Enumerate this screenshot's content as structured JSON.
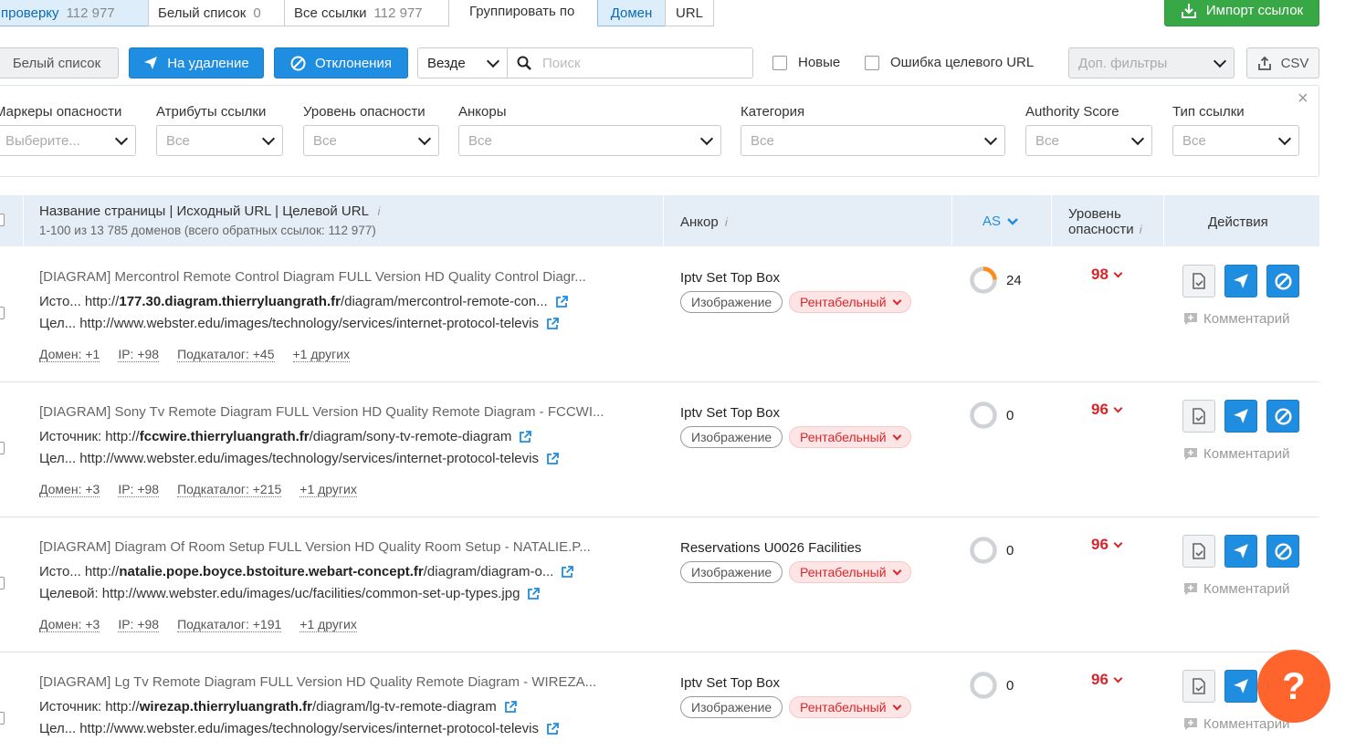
{
  "top_tabs": [
    {
      "label": "проверку",
      "count": "112 977"
    },
    {
      "label": "Белый список",
      "count": "0"
    },
    {
      "label": "Все ссылки",
      "count": "112 977"
    }
  ],
  "group_by": {
    "label": "Группировать по",
    "options": [
      "Домен",
      "URL"
    ],
    "active": "Домен"
  },
  "import_button": "Импорт ссылок",
  "toolbar": {
    "whitelist": "Белый список",
    "to_delete": "На удаление",
    "rejections": "Отклонения",
    "scope_select": "Везде",
    "search_placeholder": "Поиск",
    "new_label": "Новые",
    "target_error_label": "Ошибка целевого URL",
    "extra_filters": "Доп. фильтры",
    "csv": "CSV"
  },
  "filters": [
    {
      "label": "Маркеры опасности",
      "value": "Выберите..."
    },
    {
      "label": "Атрибуты ссылки",
      "value": "Все"
    },
    {
      "label": "Уровень опасности",
      "value": "Все"
    },
    {
      "label": "Анкоры",
      "value": "Все"
    },
    {
      "label": "Категория",
      "value": "Все"
    },
    {
      "label": "Authority Score",
      "value": "Все"
    },
    {
      "label": "Тип ссылки",
      "value": "Все"
    }
  ],
  "close_symbol": "×",
  "table_header": {
    "page_col": "Название страницы | Исходный URL | Целевой URL",
    "page_col_sub": "1-100 из 13 785 доменов (всего обратных ссылок: 112 977)",
    "anchor_col": "Анкор",
    "as_col": "AS",
    "tox_col_1": "Уровень",
    "tox_col_2": "опасности",
    "actions_col": "Действия",
    "info": "i"
  },
  "rows": [
    {
      "title": "[DIAGRAM] Mercontrol Remote Control Diagram FULL Version HD Quality Control Diagr...",
      "src_label": "Исто...",
      "src_pre": "http://",
      "src_bold": "177.30.diagram.thierryluangrath.fr",
      "src_post": "/diagram/mercontrol-remote-con...",
      "tgt_label": "Цел...",
      "tgt_url": "http://www.webster.edu/images/technology/services/internet-protocol-televis",
      "meta": [
        "Домен: +1",
        "IP: +98",
        "Подкаталог: +45",
        "+1 других"
      ],
      "anchor": "Iptv Set Top Box",
      "type_tag": "Изображение",
      "status_tag": "Рентабельный",
      "as": "24",
      "as_fraction": 0.24,
      "tox": "98",
      "comment": "Комментарий"
    },
    {
      "title": "[DIAGRAM] Sony Tv Remote Diagram FULL Version HD Quality Remote Diagram - FCCWI...",
      "src_label": "Источник:",
      "src_pre": "http://",
      "src_bold": "fccwire.thierryluangrath.fr",
      "src_post": "/diagram/sony-tv-remote-diagram",
      "tgt_label": "Цел...",
      "tgt_url": "http://www.webster.edu/images/technology/services/internet-protocol-televis",
      "meta": [
        "Домен: +3",
        "IP: +98",
        "Подкаталог: +215",
        "+1 других"
      ],
      "anchor": "Iptv Set Top Box",
      "type_tag": "Изображение",
      "status_tag": "Рентабельный",
      "as": "0",
      "as_fraction": 0,
      "tox": "96",
      "comment": "Комментарий"
    },
    {
      "title": "[DIAGRAM] Diagram Of Room Setup FULL Version HD Quality Room Setup - NATALIE.P...",
      "src_label": "Исто...",
      "src_pre": "http://",
      "src_bold": "natalie.pope.boyce.bstoiture.webart-concept.fr",
      "src_post": "/diagram/diagram-o...",
      "tgt_label": "Целевой:",
      "tgt_url": "http://www.webster.edu/images/uc/facilities/common-set-up-types.jpg",
      "meta": [
        "Домен: +3",
        "IP: +98",
        "Подкаталог: +191",
        "+1 других"
      ],
      "anchor": "Reservations U0026 Facilities",
      "type_tag": "Изображение",
      "status_tag": "Рентабельный",
      "as": "0",
      "as_fraction": 0,
      "tox": "96",
      "comment": "Комментарий"
    },
    {
      "title": "[DIAGRAM] Lg Tv Remote Diagram FULL Version HD Quality Remote Diagram - WIREZA...",
      "src_label": "Источник:",
      "src_pre": "http://",
      "src_bold": "wirezap.thierryluangrath.fr",
      "src_post": "/diagram/lg-tv-remote-diagram",
      "tgt_label": "Цел...",
      "tgt_url": "http://www.webster.edu/images/technology/services/internet-protocol-televis",
      "meta": [],
      "anchor": "Iptv Set Top Box",
      "type_tag": "Изображение",
      "status_tag": "Рентабельный",
      "as": "0",
      "as_fraction": 0,
      "tox": "96",
      "comment": "Комментарий"
    }
  ],
  "help_button": "?",
  "colors": {
    "accent": "#1f8de0",
    "danger": "#d7262b",
    "success": "#37a845",
    "help": "#ff642d"
  }
}
